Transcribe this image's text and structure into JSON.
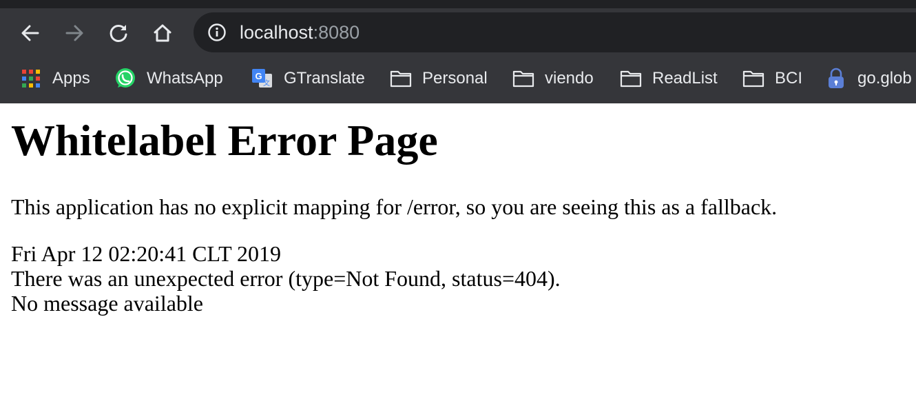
{
  "browser": {
    "address_bar": {
      "host": "localhost",
      "port": ":8080"
    },
    "bookmarks": [
      {
        "label": "Apps",
        "icon": "apps-grid-icon"
      },
      {
        "label": "WhatsApp",
        "icon": "whatsapp-icon"
      },
      {
        "label": "GTranslate",
        "icon": "google-translate-icon"
      },
      {
        "label": "Personal",
        "icon": "folder-icon"
      },
      {
        "label": "viendo",
        "icon": "folder-icon"
      },
      {
        "label": "ReadList",
        "icon": "folder-icon"
      },
      {
        "label": "BCI",
        "icon": "folder-icon"
      },
      {
        "label": "go.glob",
        "icon": "lock-icon"
      }
    ],
    "colors": {
      "chrome_bg": "#35363a",
      "omnibox_bg": "#202124",
      "text_light": "#e8eaed",
      "text_dim": "#9aa0a6"
    }
  },
  "page": {
    "title": "Whitelabel Error Page",
    "description": "This application has no explicit mapping for /error, so you are seeing this as a fallback.",
    "timestamp": "Fri Apr 12 02:20:41 CLT 2019",
    "error_line": "There was an unexpected error (type=Not Found, status=404).",
    "message": "No message available"
  }
}
